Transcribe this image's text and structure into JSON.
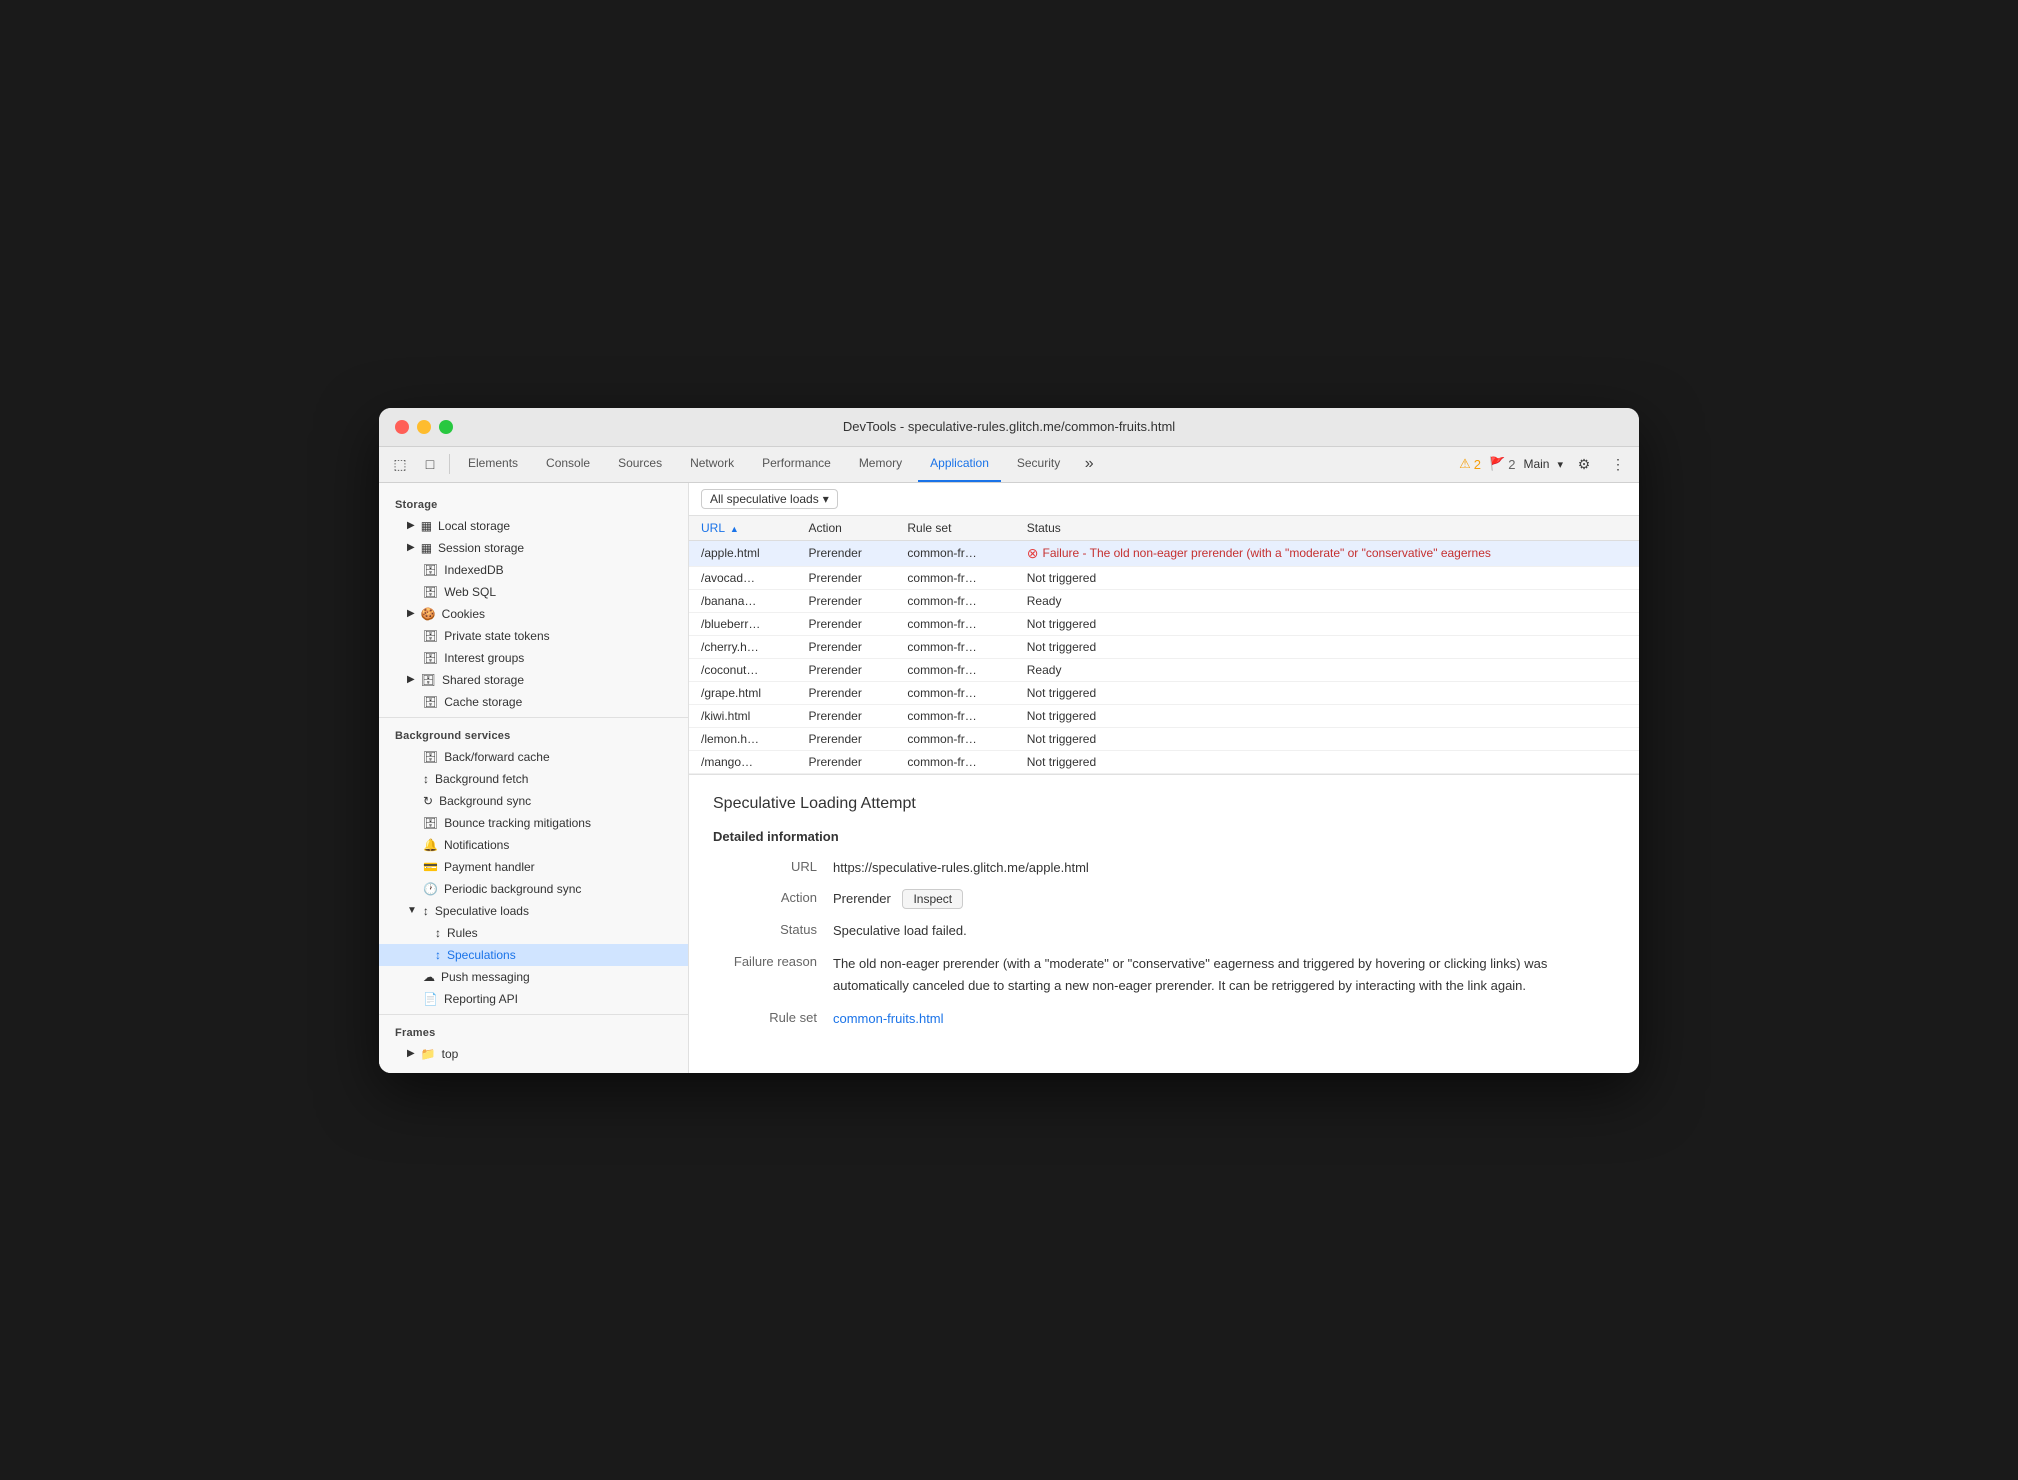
{
  "window": {
    "title": "DevTools - speculative-rules.glitch.me/common-fruits.html"
  },
  "toolbar": {
    "tabs": [
      {
        "id": "elements",
        "label": "Elements",
        "active": false
      },
      {
        "id": "console",
        "label": "Console",
        "active": false
      },
      {
        "id": "sources",
        "label": "Sources",
        "active": false
      },
      {
        "id": "network",
        "label": "Network",
        "active": false
      },
      {
        "id": "performance",
        "label": "Performance",
        "active": false
      },
      {
        "id": "memory",
        "label": "Memory",
        "active": false
      },
      {
        "id": "application",
        "label": "Application",
        "active": true
      },
      {
        "id": "security",
        "label": "Security",
        "active": false
      }
    ],
    "warnings_count": "2",
    "errors_count": "2",
    "main_label": "Main"
  },
  "filter": {
    "label": "All speculative loads",
    "dropdown_icon": "▾"
  },
  "table": {
    "columns": [
      "URL",
      "Action",
      "Rule set",
      "Status"
    ],
    "rows": [
      {
        "url": "/apple.html",
        "action": "Prerender",
        "rule_set": "common-fr…",
        "status": "error",
        "status_text": "Failure - The old non-eager prerender (with a \"moderate\" or \"conservative\" eagernes",
        "selected": true
      },
      {
        "url": "/avocad…",
        "action": "Prerender",
        "rule_set": "common-fr…",
        "status": "text",
        "status_text": "Not triggered",
        "selected": false
      },
      {
        "url": "/banana…",
        "action": "Prerender",
        "rule_set": "common-fr…",
        "status": "text",
        "status_text": "Ready",
        "selected": false
      },
      {
        "url": "/blueberr…",
        "action": "Prerender",
        "rule_set": "common-fr…",
        "status": "text",
        "status_text": "Not triggered",
        "selected": false
      },
      {
        "url": "/cherry.h…",
        "action": "Prerender",
        "rule_set": "common-fr…",
        "status": "text",
        "status_text": "Not triggered",
        "selected": false
      },
      {
        "url": "/coconut…",
        "action": "Prerender",
        "rule_set": "common-fr…",
        "status": "text",
        "status_text": "Ready",
        "selected": false
      },
      {
        "url": "/grape.html",
        "action": "Prerender",
        "rule_set": "common-fr…",
        "status": "text",
        "status_text": "Not triggered",
        "selected": false
      },
      {
        "url": "/kiwi.html",
        "action": "Prerender",
        "rule_set": "common-fr…",
        "status": "text",
        "status_text": "Not triggered",
        "selected": false
      },
      {
        "url": "/lemon.h…",
        "action": "Prerender",
        "rule_set": "common-fr…",
        "status": "text",
        "status_text": "Not triggered",
        "selected": false
      },
      {
        "url": "/mango…",
        "action": "Prerender",
        "rule_set": "common-fr…",
        "status": "text",
        "status_text": "Not triggered",
        "selected": false
      }
    ]
  },
  "detail": {
    "title": "Speculative Loading Attempt",
    "section_title": "Detailed information",
    "url_label": "URL",
    "url_value": "https://speculative-rules.glitch.me/apple.html",
    "action_label": "Action",
    "action_value": "Prerender",
    "inspect_label": "Inspect",
    "status_label": "Status",
    "status_value": "Speculative load failed.",
    "failure_reason_label": "Failure reason",
    "failure_reason_text": "The old non-eager prerender (with a \"moderate\" or \"conservative\" eagerness and triggered by hovering or clicking links) was automatically canceled due to starting a new non-eager prerender. It can be retriggered by interacting with the link again.",
    "rule_set_label": "Rule set",
    "rule_set_value": "common-fruits.html",
    "rule_set_link": "#"
  },
  "sidebar": {
    "storage_title": "Storage",
    "items_storage": [
      {
        "id": "local-storage",
        "label": "Local storage",
        "icon": "grid",
        "indent": 1,
        "has_arrow": true
      },
      {
        "id": "session-storage",
        "label": "Session storage",
        "icon": "grid",
        "indent": 1,
        "has_arrow": true
      },
      {
        "id": "indexeddb",
        "label": "IndexedDB",
        "icon": "db",
        "indent": 1,
        "has_arrow": false
      },
      {
        "id": "web-sql",
        "label": "Web SQL",
        "icon": "db",
        "indent": 1,
        "has_arrow": false
      },
      {
        "id": "cookies",
        "label": "Cookies",
        "icon": "cookie",
        "indent": 1,
        "has_arrow": true
      },
      {
        "id": "private-state-tokens",
        "label": "Private state tokens",
        "icon": "db",
        "indent": 1,
        "has_arrow": false
      },
      {
        "id": "interest-groups",
        "label": "Interest groups",
        "icon": "db",
        "indent": 1,
        "has_arrow": false
      },
      {
        "id": "shared-storage",
        "label": "Shared storage",
        "icon": "db",
        "indent": 1,
        "has_arrow": true
      },
      {
        "id": "cache-storage",
        "label": "Cache storage",
        "icon": "db",
        "indent": 1,
        "has_arrow": false
      }
    ],
    "bg_services_title": "Background services",
    "items_bg": [
      {
        "id": "back-forward-cache",
        "label": "Back/forward cache",
        "icon": "db",
        "indent": 1
      },
      {
        "id": "background-fetch",
        "label": "Background fetch",
        "icon": "fetch",
        "indent": 1
      },
      {
        "id": "background-sync",
        "label": "Background sync",
        "icon": "sync",
        "indent": 1
      },
      {
        "id": "bounce-tracking",
        "label": "Bounce tracking mitigations",
        "icon": "db",
        "indent": 1
      },
      {
        "id": "notifications",
        "label": "Notifications",
        "icon": "bell",
        "indent": 1
      },
      {
        "id": "payment-handler",
        "label": "Payment handler",
        "icon": "payment",
        "indent": 1
      },
      {
        "id": "periodic-bg-sync",
        "label": "Periodic background sync",
        "icon": "clock",
        "indent": 1
      },
      {
        "id": "speculative-loads",
        "label": "Speculative loads",
        "icon": "spec",
        "indent": 1,
        "has_arrow": true,
        "expanded": true
      },
      {
        "id": "rules",
        "label": "Rules",
        "icon": "spec",
        "indent": 2
      },
      {
        "id": "speculations",
        "label": "Speculations",
        "icon": "spec",
        "indent": 2,
        "active": true
      },
      {
        "id": "push-messaging",
        "label": "Push messaging",
        "icon": "cloud",
        "indent": 1
      },
      {
        "id": "reporting-api",
        "label": "Reporting API",
        "icon": "doc",
        "indent": 1
      }
    ],
    "frames_title": "Frames",
    "items_frames": [
      {
        "id": "top",
        "label": "top",
        "icon": "folder",
        "indent": 1,
        "has_arrow": true
      }
    ]
  }
}
